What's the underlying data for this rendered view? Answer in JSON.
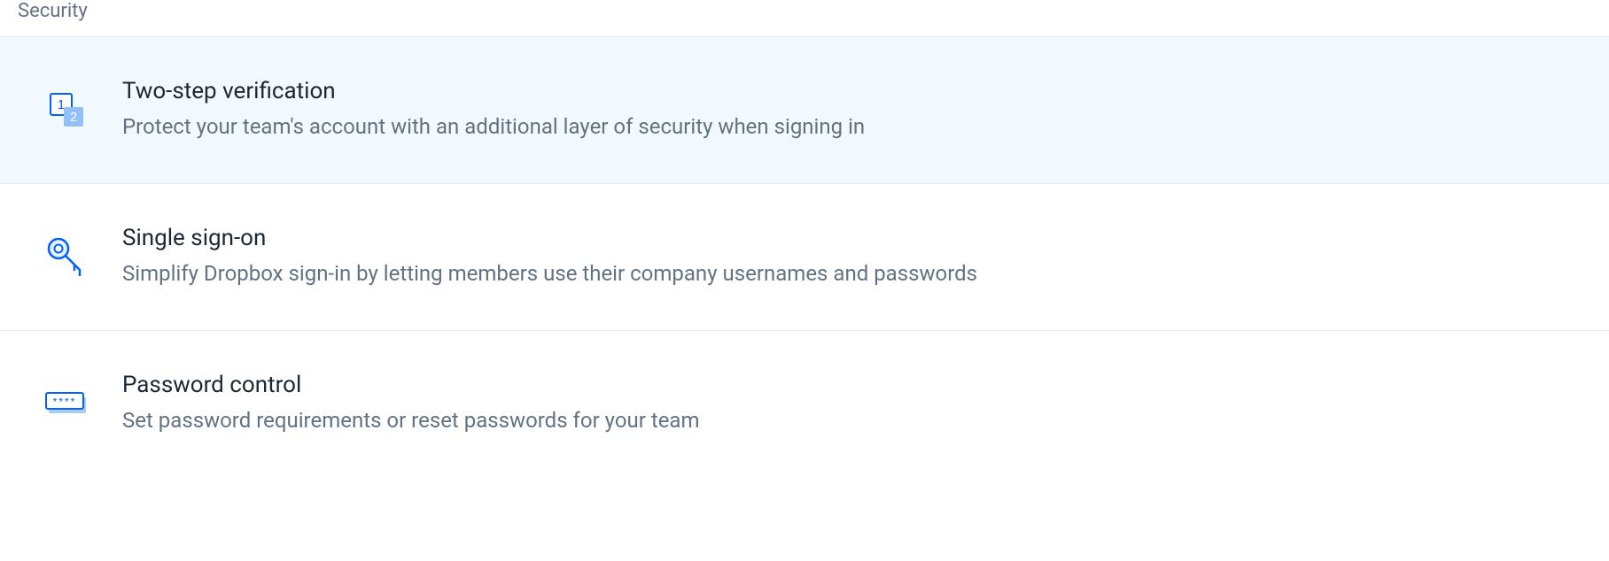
{
  "section": {
    "title": "Security"
  },
  "settings": {
    "two_step": {
      "title": "Two-step verification",
      "description": "Protect your team's account with an additional layer of security when signing in"
    },
    "sso": {
      "title": "Single sign-on",
      "description": "Simplify Dropbox sign-in by letting members use their company usernames and passwords"
    },
    "password_control": {
      "title": "Password control",
      "description": "Set password requirements or reset passwords for your team"
    }
  }
}
